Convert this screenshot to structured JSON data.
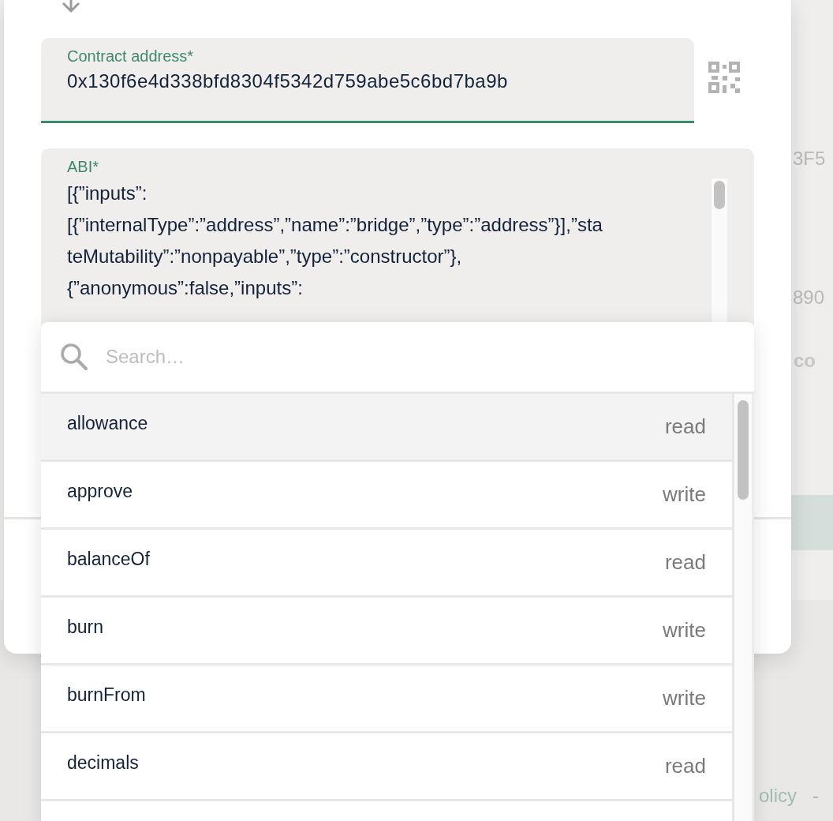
{
  "background_page": {
    "texts": [
      "3F5",
      "890",
      "co"
    ],
    "footer": [
      "olicy",
      "-"
    ]
  },
  "contract_address": {
    "label": "Contract address*",
    "value": "0x130f6e4d338bfd8304f5342d759abe5c6bd7ba9b"
  },
  "abi": {
    "label": "ABI*",
    "lines": [
      "[{”inputs”:",
      "[{”internalType”:”address”,”name”:”bridge”,”type”:”address”}],”sta",
      "teMutability”:”nonpayable”,”type”:”constructor”},",
      "{”anonymous”:false,”inputs”:"
    ]
  },
  "method_dropdown": {
    "search": {
      "placeholder": "Search…"
    },
    "items": [
      {
        "name": "allowance",
        "type": "read",
        "selected": true
      },
      {
        "name": "approve",
        "type": "write",
        "selected": false
      },
      {
        "name": "balanceOf",
        "type": "read",
        "selected": false
      },
      {
        "name": "burn",
        "type": "write",
        "selected": false
      },
      {
        "name": "burnFrom",
        "type": "write",
        "selected": false
      },
      {
        "name": "decimals",
        "type": "read",
        "selected": false
      }
    ]
  }
}
